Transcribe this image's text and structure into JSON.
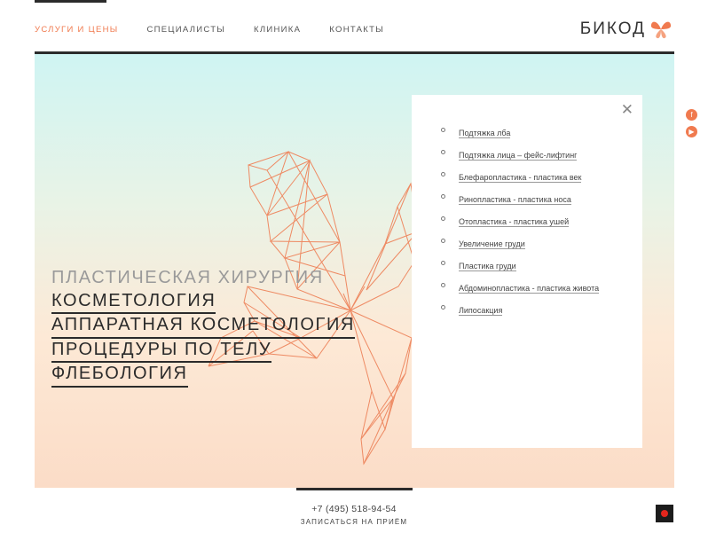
{
  "nav": {
    "items": [
      {
        "label": "Услуги и цены",
        "active": true
      },
      {
        "label": "Специалисты",
        "active": false
      },
      {
        "label": "Клиника",
        "active": false
      },
      {
        "label": "Контакты",
        "active": false
      }
    ]
  },
  "logo": {
    "text": "БИКОД",
    "icon": "butterfly-icon"
  },
  "hero": {
    "categories": [
      "Пластическая хирургия",
      "Косметология",
      "Аппаратная косметология",
      "Процедуры по телу",
      "Флебология"
    ]
  },
  "services_panel": {
    "close_icon": "close-icon",
    "items": [
      "Подтяжка лба",
      "Подтяжка лица – фейс-лифтинг",
      "Блефаропластика - пластика век",
      "Ринопластика - пластика носа",
      "Отопластика - пластика ушей",
      "Увеличение груди",
      "Пластика груди",
      "Абдоминопластика - пластика живота",
      "Липосакция"
    ]
  },
  "social": {
    "icons": [
      "facebook-icon",
      "youtube-icon"
    ]
  },
  "footer": {
    "phone": "+7 (495) 518-94-54",
    "book": "Записаться на приём"
  },
  "colors": {
    "accent": "#f07a4f",
    "dark": "#2b2b2b"
  }
}
